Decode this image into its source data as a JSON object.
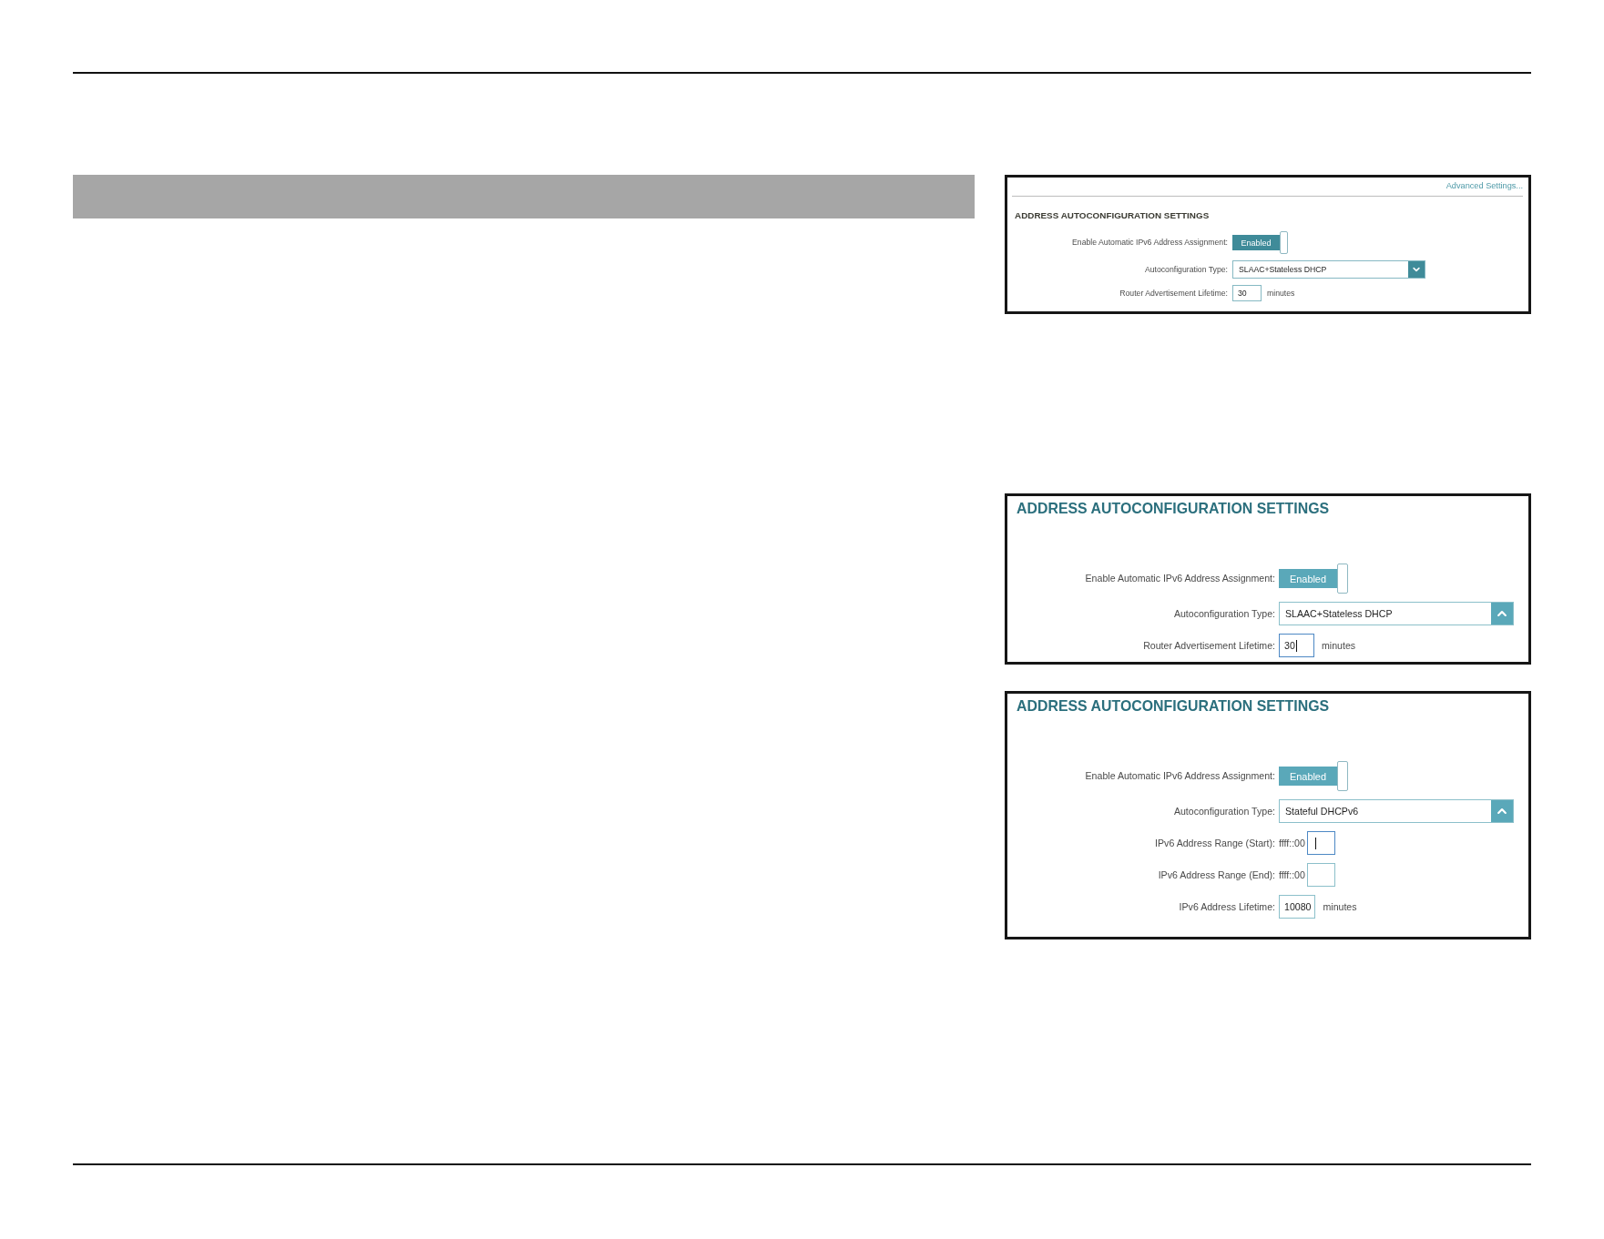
{
  "panels": [
    {
      "kind": "compact",
      "link": "Advanced Settings...",
      "heading": "ADDRESS AUTOCONFIGURATION SETTINGS",
      "rows": [
        {
          "kind": "toggle",
          "label": "Enable Automatic IPv6 Address Assignment:",
          "value": "Enabled",
          "on": true
        },
        {
          "kind": "select",
          "label": "Autoconfiguration Type:",
          "value": "SLAAC+Stateless DHCP",
          "expanded": false
        },
        {
          "kind": "input",
          "label": "Router Advertisement Lifetime:",
          "value": "30",
          "unit": "minutes",
          "focused": false
        }
      ]
    },
    {
      "kind": "zoomed",
      "heading": "ADDRESS AUTOCONFIGURATION SETTINGS",
      "rows": [
        {
          "kind": "toggle",
          "label": "Enable Automatic IPv6 Address Assignment:",
          "value": "Enabled",
          "on": true
        },
        {
          "kind": "select",
          "label": "Autoconfiguration Type:",
          "value": "SLAAC+Stateless DHCP",
          "expanded": true
        },
        {
          "kind": "input",
          "label": "Router Advertisement Lifetime:",
          "value": "30",
          "unit": "minutes",
          "focused": true
        }
      ]
    },
    {
      "kind": "zoomed",
      "heading": "ADDRESS AUTOCONFIGURATION SETTINGS",
      "rows": [
        {
          "kind": "toggle",
          "label": "Enable Automatic IPv6 Address Assignment:",
          "value": "Enabled",
          "on": true
        },
        {
          "kind": "select",
          "label": "Autoconfiguration Type:",
          "value": "Stateful DHCPv6",
          "expanded": true
        },
        {
          "kind": "prefixed",
          "label": "IPv6 Address Range (Start):",
          "prefix": "ffff::00",
          "focused": true
        },
        {
          "kind": "prefixed",
          "label": "IPv6 Address Range (End):",
          "prefix": "ffff::00",
          "focused": false
        },
        {
          "kind": "input",
          "label": "IPv6 Address Lifetime:",
          "value": "10080",
          "unit": "minutes",
          "focused": false
        }
      ]
    }
  ]
}
